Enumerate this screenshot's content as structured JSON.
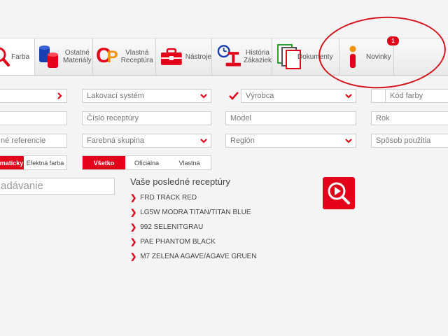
{
  "tabs": {
    "farba": "Farba",
    "ostatne": "Ostatné\nMateriály",
    "vlastna": "Vlastná\nReceptúra",
    "nastroje": "Nástroje",
    "historia": "História\nZákaziek",
    "dokumenty": "Dokumenty",
    "novinky": "Novinky",
    "novinky_badge": "1"
  },
  "filters": {
    "lakovaci_system": "Lakovací systém",
    "vyrobca": "Výrobca",
    "kod_farby": "Kód farby",
    "cislo_receptury": "Číslo receptúry",
    "model": "Model",
    "rok": "Rok",
    "referencie": "né referencie",
    "farebna_skupina": "Farebná skupina",
    "region": "Región",
    "sposob_pouzitia": "Spôsob použitia"
  },
  "toggles": {
    "type_left": "maticky",
    "type_right": "Efektná farba",
    "scope_all": "Všetko",
    "scope_official": "Oficiálna",
    "scope_own": "Vlastná"
  },
  "search": {
    "partial_text": "adávanie"
  },
  "recent": {
    "title": "Vaše posledné receptúry",
    "items": [
      "FRD TRACK RED",
      "LG5W MODRA TITAN/TITAN BLUE",
      "992 SELENITGRAU",
      "PAE PHANTOM BLACK",
      "M7 ZELENA AGAVE/AGAVE GRUEN"
    ]
  },
  "colors": {
    "accent": "#e2001a",
    "annotation": "#d4141c"
  }
}
